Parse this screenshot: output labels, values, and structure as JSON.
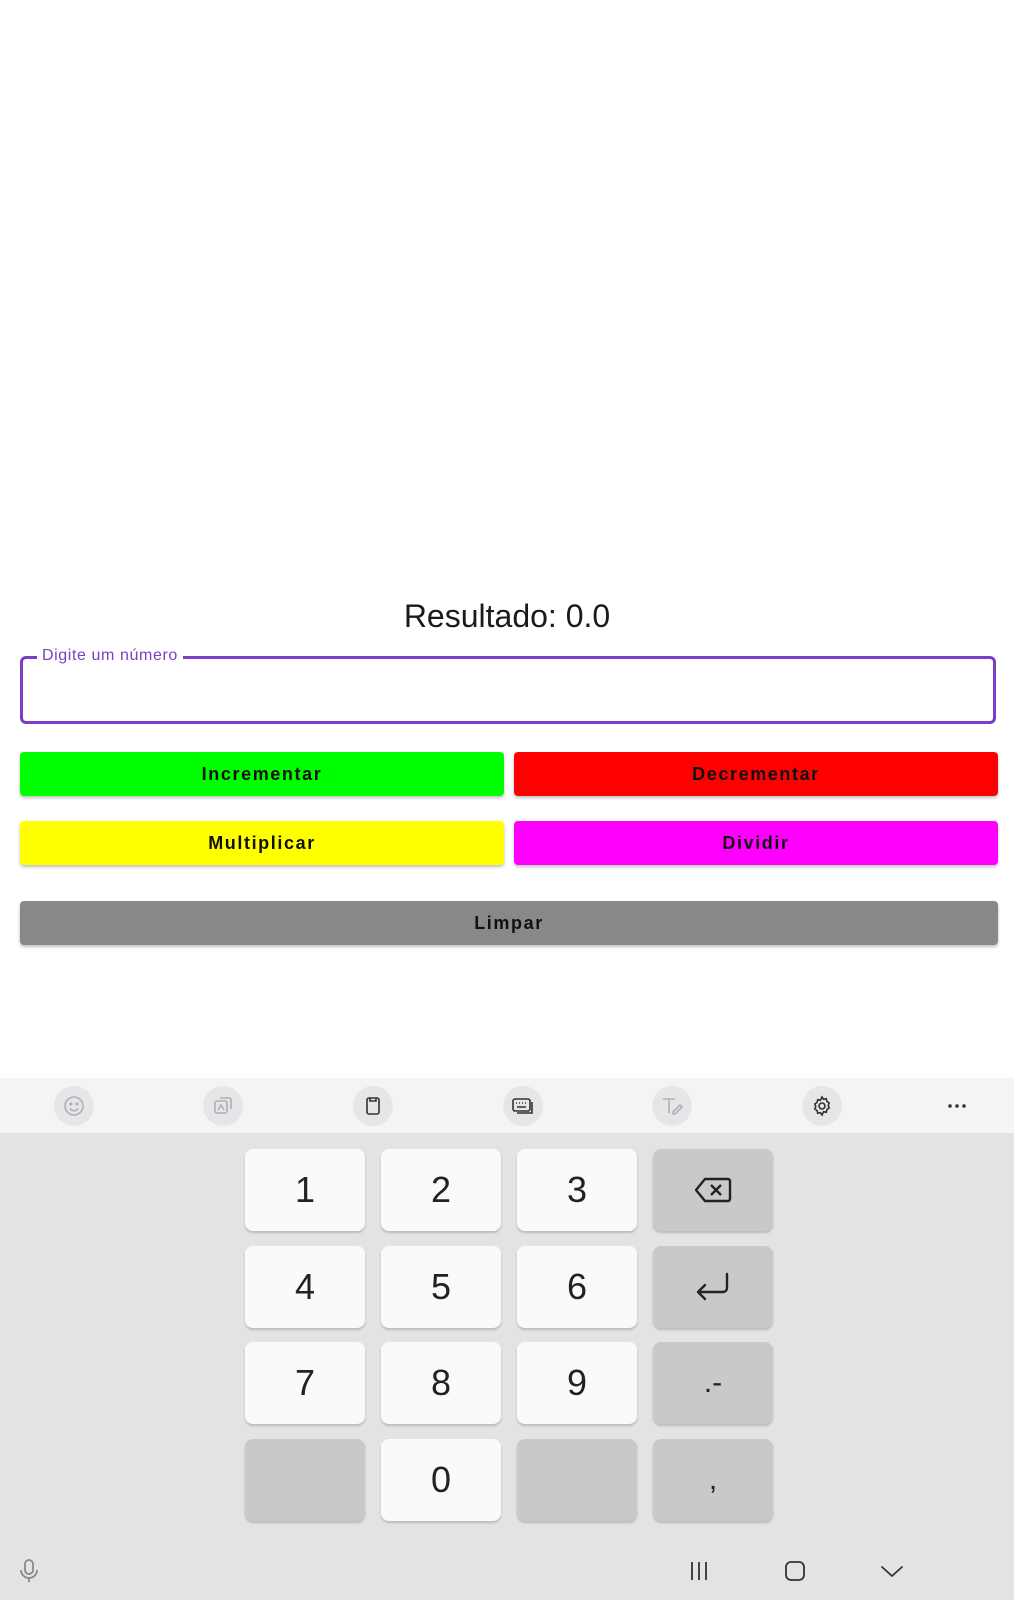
{
  "result": {
    "text": "Resultado: 0.0"
  },
  "input": {
    "label": "Digite um número",
    "value": ""
  },
  "buttons": {
    "increment": "Incrementar",
    "decrement": "Decrementar",
    "multiply": "Multiplicar",
    "divide": "Dividir",
    "clear": "Limpar"
  },
  "colors": {
    "increment": "#00ff00",
    "decrement": "#ff0000",
    "multiply": "#ffff00",
    "divide": "#ff00ff",
    "clear": "#888888",
    "field_accent": "#7b3fc3"
  },
  "keyboard": {
    "toolbar_icons": [
      "emoji-icon",
      "sticker-icon",
      "clipboard-icon",
      "keyboard-mode-icon",
      "handwriting-icon",
      "settings-icon",
      "more-icon"
    ],
    "keys": {
      "k1": "1",
      "k2": "2",
      "k3": "3",
      "k4": "4",
      "k5": "5",
      "k6": "6",
      "k7": "7",
      "k8": "8",
      "k9": "9",
      "k0": "0",
      "dot_minus": ".-",
      "comma": ","
    }
  },
  "navbar": {
    "icons": [
      "mic-icon",
      "recent-apps-icon",
      "home-icon",
      "hide-keyboard-icon"
    ]
  }
}
